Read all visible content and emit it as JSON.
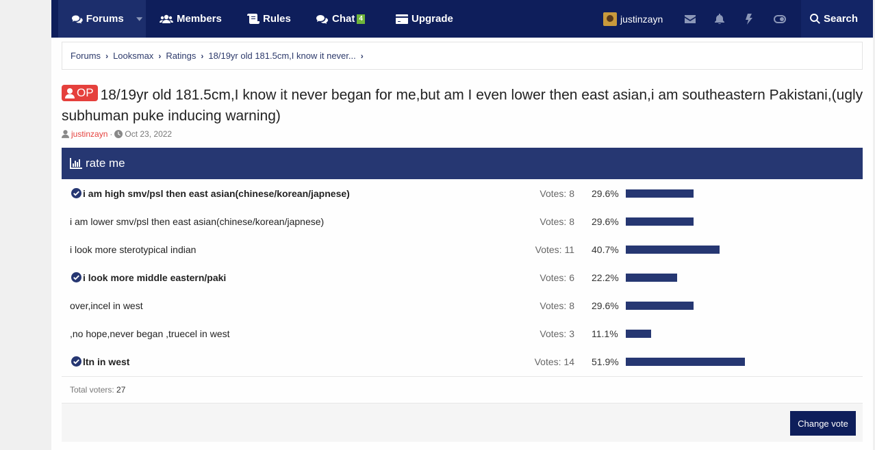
{
  "nav": {
    "forums": "Forums",
    "members": "Members",
    "rules": "Rules",
    "chat": "Chat",
    "chat_badge": "4",
    "upgrade": "Upgrade",
    "username": "justinzayn",
    "search": "Search"
  },
  "breadcrumb": [
    "Forums",
    "Looksmax",
    "Ratings",
    "18/19yr old 181.5cm,I know it never..."
  ],
  "thread": {
    "op_label": "OP",
    "title": "18/19yr old 181.5cm,I know it never began for me,but am I even lower then east asian,i am southeastern Pakistani,(ugly subhuman puke inducing warning)",
    "author": "justinzayn",
    "separator": "·",
    "date": "Oct 23, 2022"
  },
  "poll": {
    "title": "rate me",
    "options": [
      {
        "label": "i am high smv/psl then east asian(chinese/korean/japnese)",
        "votes": "Votes: 8",
        "percent": "29.6%",
        "fraction": 0.296,
        "voted": true
      },
      {
        "label": "i am lower smv/psl then east asian(chinese/korean/japnese)",
        "votes": "Votes: 8",
        "percent": "29.6%",
        "fraction": 0.296,
        "voted": false
      },
      {
        "label": "i look more sterotypical indian",
        "votes": "Votes: 11",
        "percent": "40.7%",
        "fraction": 0.407,
        "voted": false
      },
      {
        "label": "i look more middle eastern/paki",
        "votes": "Votes: 6",
        "percent": "22.2%",
        "fraction": 0.222,
        "voted": true
      },
      {
        "label": "over,incel in west",
        "votes": "Votes: 8",
        "percent": "29.6%",
        "fraction": 0.296,
        "voted": false
      },
      {
        "label": ",no hope,never began ,truecel in west",
        "votes": "Votes: 3",
        "percent": "11.1%",
        "fraction": 0.111,
        "voted": false
      },
      {
        "label": "ltn in west",
        "votes": "Votes: 14",
        "percent": "51.9%",
        "fraction": 0.519,
        "voted": true
      }
    ],
    "total_label": "Total voters:",
    "total_value": "27",
    "change_vote": "Change vote"
  },
  "colors": {
    "nav_bg": "#0e1e5b",
    "poll_header": "#263772",
    "bar": "#263772",
    "op_badge": "#e5403c",
    "chat_badge": "#6fb53a"
  }
}
